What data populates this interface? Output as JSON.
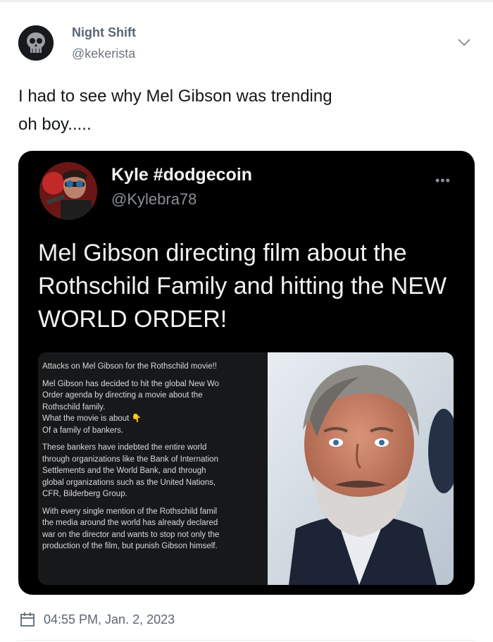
{
  "author": {
    "name": "Night Shift",
    "handle": "@kekerista"
  },
  "tweet": {
    "text_line1": "I had to see why Mel Gibson was trending",
    "text_line2": "oh boy....."
  },
  "quoted_post": {
    "name": "Kyle #dodgecoin",
    "handle": "@Kylebra78",
    "more_label": "•••",
    "headline": "Mel Gibson directing film about the Rothschild Family and hitting the NEW WORLD ORDER!",
    "image_text": {
      "title": "Attacks on Mel Gibson for the Rothschild movie!!",
      "para1": [
        "Mel Gibson has decided to hit the global New Wo",
        "Order agenda by directing a movie about the",
        "Rothschild family.",
        "What the movie is about 👇",
        "Of a family of bankers."
      ],
      "para2": [
        "These bankers have indebted the entire world",
        "through organizations like the Bank of Internation",
        "Settlements and the World Bank, and through",
        "global organizations such as the United Nations,",
        "CFR, Bilderberg Group."
      ],
      "para3": [
        "With every single mention of the Rothschild famil",
        "the media around the world has already declared",
        "war on the director and wants to stop not only the",
        "production of the film, but punish Gibson himself."
      ]
    }
  },
  "timestamp": "04:55 PM, Jan. 2, 2023",
  "icons": {
    "calendar": "calendar-icon",
    "chevron": "chevron-down-icon"
  },
  "colors": {
    "embed_bg": "#000000",
    "meta_gray": "#5b6670"
  }
}
